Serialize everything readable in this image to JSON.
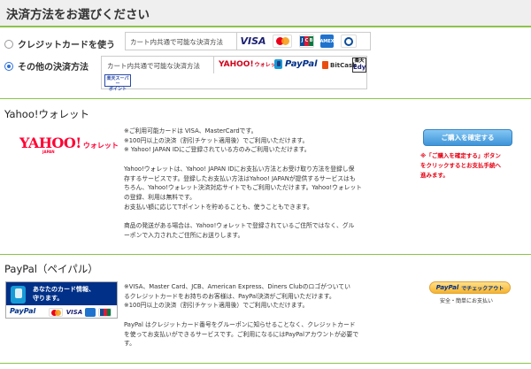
{
  "header": {
    "title": "決済方法をお選びください"
  },
  "options": [
    {
      "label": "クレジットカードを使う",
      "selected": false,
      "box_label": "カート内共通で可能な決済方法",
      "cards": [
        "VISA",
        "MasterCard",
        "JCB",
        "AMEX",
        "Diners"
      ]
    },
    {
      "label": "その他の決済方法",
      "selected": true,
      "box_label": "カート内共通で可能な決済方法",
      "methods": {
        "yahoo": "YAHOO!",
        "yahoo_sub": "ウォレット",
        "paypal": "PayPal",
        "bitcash": "BitCash",
        "edy_top": "楽天",
        "edy_main": "Edy",
        "rakuten_l1": "楽天スーパー",
        "rakuten_l2": "ポイント"
      }
    }
  ],
  "yahoo_section": {
    "title": "Yahoo!ウォレット",
    "logo_main": "YAHOO!",
    "logo_sub": "ウォレット",
    "logo_japan": "JAPAN",
    "lines": [
      "※ご利用可能カードは VISA、MasterCardです。",
      "※100円以上の決済（割引チケット適用後）でご利用いただけます。",
      "※ Yahoo! JAPAN IDにご登録されている方のみご利用いただけます。",
      "",
      "Yahoo!ウォレットは、Yahoo! JAPAN IDにお支払い方法とお受け取り方法を登録し保",
      "存するサービスです。登録したお支払い方法はYahoo! JAPANが提供するサービスはも",
      "ちろん、Yahoo!ウォレット決済対応サイトでもご利用いただけます。Yahoo!ウォレット",
      "の登録、利用は無料です。",
      "お支払い額に応じてTポイントを貯めることも、使うこともできます。",
      "",
      "商品の発送がある場合は、Yahoo!ウォレットで登録されているご住所ではなく、グル",
      "ーポンで入力されたご住所にお送りします。"
    ],
    "confirm_button": "ご購入を確定する",
    "note_lines": [
      "※「ご購入を確定する」ボタン",
      "をクリックするとお支払手続へ",
      "進みます。"
    ]
  },
  "paypal_section": {
    "title": "PayPal（ペイパル）",
    "badge_line1": "あなたのカード情報、",
    "badge_line2": "守ります。",
    "badge_brand": "PayPal",
    "lines": [
      "※VISA、Master Card、JCB、American Express、Diners Clubのロゴがついてい",
      "るクレジットカードをお持ちのお客様は、PayPal決済がご利用いただけます。",
      "※100円以上の決済（割引チケット適用後）でご利用いただけます。",
      "",
      "PayPal はクレジットカード番号をグルーポンに知らせることなく、クレジットカード",
      "を使ってお支払いができるサービスです。ご利用になるにはPayPalアカウントが必要で",
      "す。"
    ],
    "checkout_brand": "PayPal",
    "checkout_label": "でチェックアウト",
    "safe_note": "安全・簡単にお支払い"
  },
  "colors": {
    "accent_green": "#8bc34a",
    "button_blue": "#3d94d8",
    "note_red": "#e50012",
    "paypal_navy": "#003087"
  }
}
